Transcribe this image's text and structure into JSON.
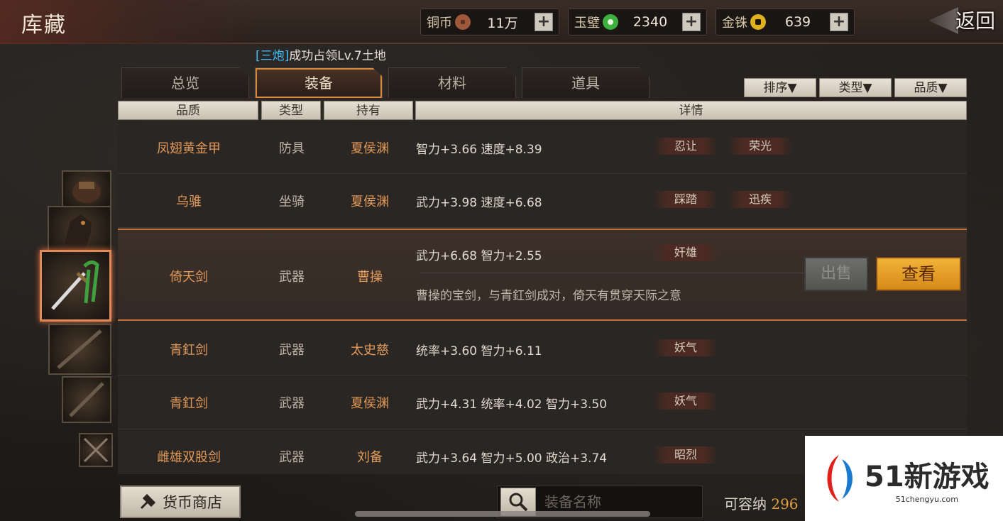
{
  "header": {
    "title": "库藏",
    "back_label": "返回"
  },
  "currencies": [
    {
      "name": "铜币",
      "value": "11万",
      "icon": "copper-coin-icon",
      "color": "#b0603a"
    },
    {
      "name": "玉璧",
      "value": "2340",
      "icon": "jade-disc-icon",
      "color": "#52c050"
    },
    {
      "name": "金铢",
      "value": "639",
      "icon": "gold-coin-icon",
      "color": "#e0b020"
    }
  ],
  "plus_label": "+",
  "notice": {
    "tag": "[三炮]",
    "text": "成功占领Lv.7土地"
  },
  "tabs": [
    {
      "label": "总览",
      "active": false
    },
    {
      "label": "装备",
      "active": true
    },
    {
      "label": "材料",
      "active": false
    },
    {
      "label": "道具",
      "active": false
    }
  ],
  "filters": [
    {
      "label": "排序▼"
    },
    {
      "label": "类型▼"
    },
    {
      "label": "品质▼"
    }
  ],
  "columns": {
    "quality": "品质",
    "type": "类型",
    "owner": "持有",
    "detail": "详情"
  },
  "rows": [
    {
      "name": "凤翅黄金甲",
      "type": "防具",
      "owner": "夏侯渊",
      "stats": "智力+3.66  速度+8.39",
      "skills": [
        "忍让",
        "荣光"
      ]
    },
    {
      "name": "乌骓",
      "type": "坐骑",
      "owner": "夏侯渊",
      "stats": "武力+3.98  速度+6.68",
      "skills": [
        "踩踏",
        "迅疾"
      ]
    },
    {
      "name": "倚天剑",
      "type": "武器",
      "owner": "曹操",
      "stats": "武力+6.68  智力+2.55",
      "skills": [
        "奸雄"
      ],
      "selected": true,
      "desc": "曹操的宝剑，与青釭剑成对，倚天有贯穿天际之意"
    },
    {
      "name": "青釭剑",
      "type": "武器",
      "owner": "太史慈",
      "stats": "统率+3.60  智力+6.11",
      "skills": [
        "妖气"
      ]
    },
    {
      "name": "青釭剑",
      "type": "武器",
      "owner": "夏侯渊",
      "stats": "武力+4.31  统率+4.02  智力+3.50",
      "skills": [
        "妖气"
      ]
    },
    {
      "name": "雌雄双股剑",
      "type": "武器",
      "owner": "刘备",
      "stats": "武力+3.64  智力+5.00  政治+3.74",
      "skills": [
        "昭烈"
      ]
    }
  ],
  "actions": {
    "sell": "出售",
    "view": "查看"
  },
  "bottom": {
    "shop_label": "货币商店",
    "search_placeholder": "装备名称",
    "capacity_label": "可容纳",
    "capacity_value": "296"
  },
  "watermark": {
    "brand": "51新游戏",
    "url": "51chengyu.com"
  }
}
